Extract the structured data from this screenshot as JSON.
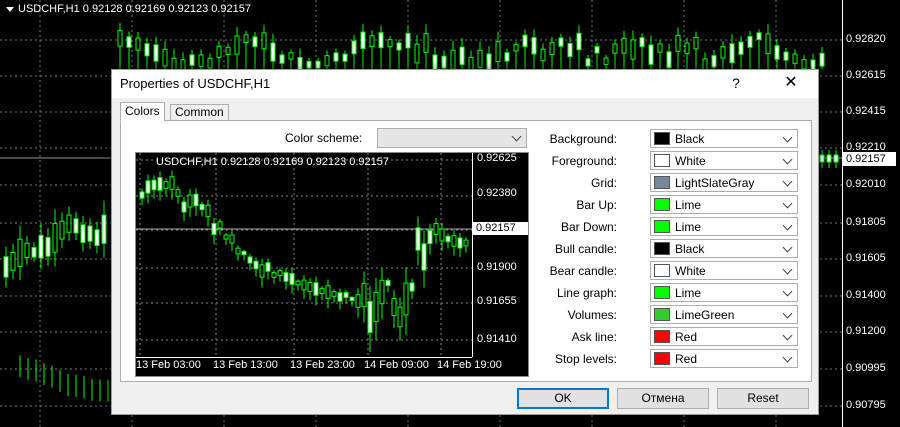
{
  "background_chart": {
    "title": "USDCHF,H1  0.92128 0.92169 0.92123 0.92157",
    "price_labels": [
      "0.92820",
      "0.92615",
      "0.92415",
      "0.92210",
      "0.92010",
      "0.91805",
      "0.91605",
      "0.91400",
      "0.91200",
      "0.90995",
      "0.90795"
    ],
    "current_price": "0.92157",
    "candle_color": "#00ff00"
  },
  "dialog": {
    "title": "Properties of USDCHF,H1",
    "help_label": "?",
    "close_label": "✕",
    "tabs": [
      {
        "label": "Colors",
        "active": true
      },
      {
        "label": "Common",
        "active": false
      }
    ],
    "color_scheme_label": "Color scheme:",
    "color_scheme_value": "",
    "preview": {
      "title": "USDCHF,H1  0.92128 0.92169 0.92123 0.92157",
      "price_labels": [
        "0.92625",
        "0.92380",
        "0.92157",
        "0.91900",
        "0.91655",
        "0.91410"
      ],
      "current_price": "0.92157",
      "time_labels": [
        "13 Feb 03:00",
        "13 Feb 13:00",
        "13 Feb 23:00",
        "14 Feb 09:00",
        "14 Feb 19:00"
      ],
      "bar_color": "#00ff00",
      "grid_color": "#778899"
    },
    "color_settings": [
      {
        "label": "Background:",
        "value": "Black",
        "swatch": "#000000"
      },
      {
        "label": "Foreground:",
        "value": "White",
        "swatch": "#ffffff"
      },
      {
        "label": "Grid:",
        "value": "LightSlateGray",
        "swatch": "#778899"
      },
      {
        "label": "Bar Up:",
        "value": "Lime",
        "swatch": "#00ff00"
      },
      {
        "label": "Bar Down:",
        "value": "Lime",
        "swatch": "#00ff00"
      },
      {
        "label": "Bull candle:",
        "value": "Black",
        "swatch": "#000000"
      },
      {
        "label": "Bear candle:",
        "value": "White",
        "swatch": "#ffffff"
      },
      {
        "label": "Line graph:",
        "value": "Lime",
        "swatch": "#00ff00"
      },
      {
        "label": "Volumes:",
        "value": "LimeGreen",
        "swatch": "#32cd32"
      },
      {
        "label": "Ask line:",
        "value": "Red",
        "swatch": "#ff0000"
      },
      {
        "label": "Stop levels:",
        "value": "Red",
        "swatch": "#ff0000"
      }
    ],
    "buttons": {
      "ok": "OK",
      "cancel": "Отмена",
      "reset": "Reset"
    }
  }
}
